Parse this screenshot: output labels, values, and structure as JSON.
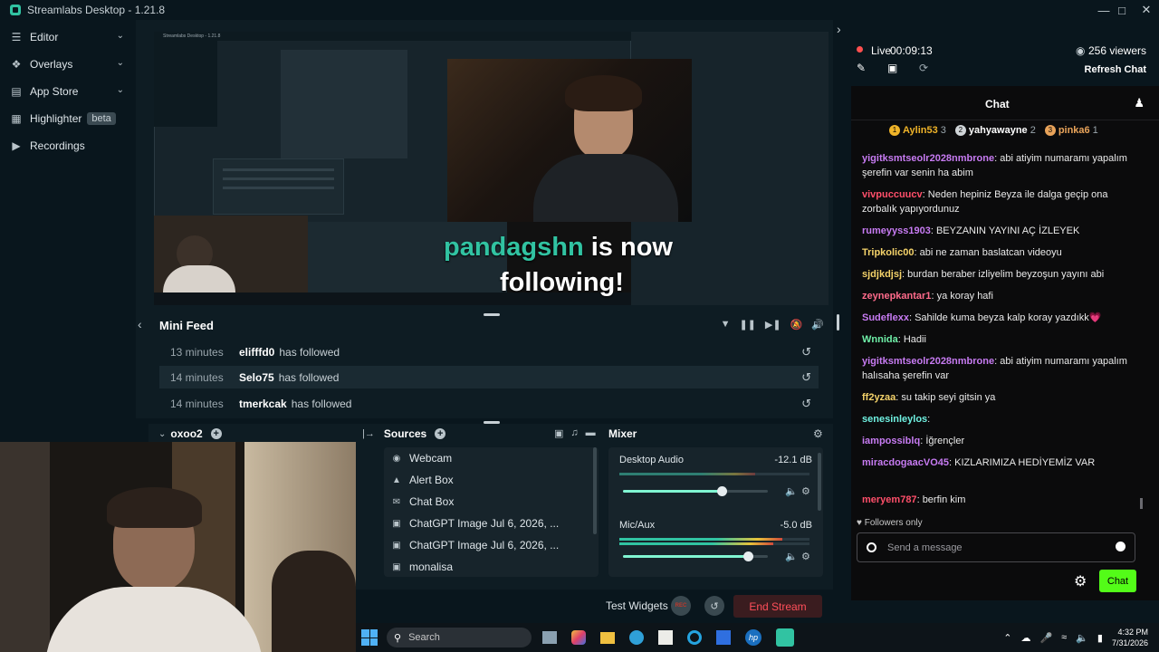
{
  "app": {
    "title": "Streamlabs Desktop - 1.21.8"
  },
  "sidebar": {
    "items": [
      {
        "label": "Editor"
      },
      {
        "label": "Overlays"
      },
      {
        "label": "App Store"
      },
      {
        "label": "Highlighter",
        "badge": "beta"
      },
      {
        "label": "Recordings"
      }
    ]
  },
  "preview": {
    "nested_title": "Streamlabs Desktop - 1.21.8",
    "follow_name": "pandagshn",
    "follow_rest": "is now",
    "follow_line2": "following!"
  },
  "mini_feed": {
    "title": "Mini Feed",
    "rows": [
      {
        "time": "13 minutes",
        "user": "elifffd0",
        "action": "has followed"
      },
      {
        "time": "14 minutes",
        "user": "Selo75",
        "action": "has followed"
      },
      {
        "time": "14 minutes",
        "user": "tmerkcak",
        "action": "has followed"
      }
    ]
  },
  "scenes": {
    "current": "oxoo2"
  },
  "sources": {
    "title": "Sources",
    "items": [
      {
        "label": "Webcam",
        "icon": "camera-icon"
      },
      {
        "label": "Alert Box",
        "icon": "alert-icon"
      },
      {
        "label": "Chat Box",
        "icon": "chat-icon"
      },
      {
        "label": "ChatGPT Image Jul 6, 2026, ...",
        "icon": "image-icon"
      },
      {
        "label": "ChatGPT Image Jul 6, 2026, ...",
        "icon": "image-icon"
      },
      {
        "label": "monalisa",
        "icon": "image-icon"
      }
    ]
  },
  "mixer": {
    "title": "Mixer",
    "channels": [
      {
        "name": "Desktop Audio",
        "db": "-12.1 dB",
        "level": 0.68
      },
      {
        "name": "Mic/Aux",
        "db": "-5.0 dB",
        "level": 0.86
      }
    ]
  },
  "footer": {
    "test_widgets": "Test Widgets",
    "rec": "REC",
    "end_stream": "End Stream"
  },
  "stream": {
    "live_label": "Live",
    "live_time": "00:09:13",
    "viewers": "256 viewers",
    "refresh": "Refresh Chat"
  },
  "chat": {
    "title": "Chat",
    "top": [
      {
        "rank": "1",
        "name": "Aylin53",
        "count": "3",
        "color": "#f0b429"
      },
      {
        "rank": "2",
        "name": "yahyawayne",
        "count": "2",
        "color": "#d0d5d8"
      },
      {
        "rank": "3",
        "name": "pinka6",
        "count": "1",
        "color": "#e8a35a"
      }
    ],
    "messages": [
      {
        "user": "yigitksmtseolr2028nmbrone",
        "text": "abi atiyim numaramı yapalım şerefin var senin ha abim",
        "color": "#c77bf2"
      },
      {
        "user": "vivpuccuucv",
        "text": "Neden hepiniz Beyza ile dalga geçip ona zorbalık yapıyordunuz",
        "color": "#ff4f6a"
      },
      {
        "user": "rumeyyss1903",
        "text": "BEYZANIN YAYINI AÇ İZLEYEK",
        "color": "#c77bf2"
      },
      {
        "user": "Tripkolic00",
        "text": "abi ne zaman baslatcan videoyu",
        "color": "#f5d36a"
      },
      {
        "user": "sjdjkdjsj",
        "text": "burdan beraber izliyelim beyzoşun yayını abi",
        "color": "#f5d36a"
      },
      {
        "user": "zeynepkantar1",
        "text": "ya koray hafi",
        "color": "#ff6b8b"
      },
      {
        "user": "Sudeflexx",
        "text": "Sahilde kuma beyza kalp koray yazdıkk💗",
        "color": "#c77bf2"
      },
      {
        "user": "Wnnida",
        "text": "Hadii",
        "color": "#6ff0a8"
      },
      {
        "user": "yigitksmtseolr2028nmbrone",
        "text": "abi atiyim numaramı yapalım halısaha şerefin var",
        "color": "#c77bf2"
      },
      {
        "user": "ff2yzaa",
        "text": "su takip seyi gitsin ya",
        "color": "#f5d36a"
      },
      {
        "user": "senesinleylos",
        "text": "",
        "color": "#6ff0e0"
      },
      {
        "user": "iampossiblq",
        "text": "İğrençler",
        "color": "#c77bf2"
      },
      {
        "user": "miracdogaacVO45",
        "text": "KIZLARIMIZA HEDİYEMİZ VAR",
        "color": "#c77bf2"
      },
      {
        "user": "meryem787",
        "text": "berfin kim",
        "color": "#ff4f6a"
      }
    ],
    "followers_only": "Followers only",
    "input_placeholder": "Send a message",
    "send_label": "Chat"
  },
  "taskbar": {
    "search_placeholder": "Search",
    "time": "4:32 PM",
    "date": "7/31/2026"
  }
}
